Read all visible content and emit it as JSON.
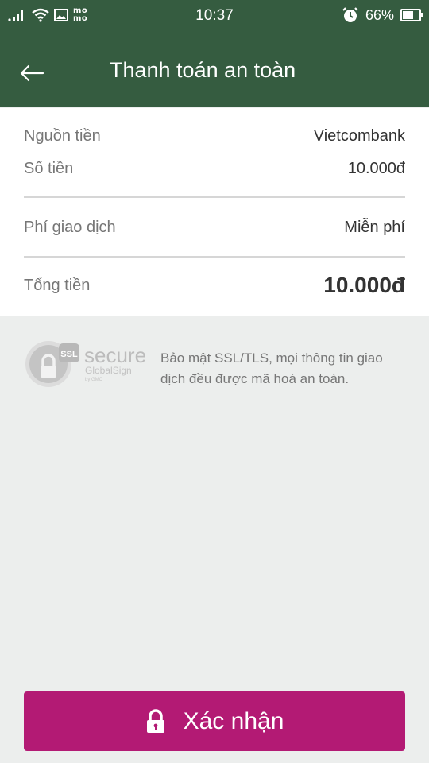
{
  "status_bar": {
    "time": "10:37",
    "battery": "66%",
    "battery_level": 0.66,
    "app_logo_top": "mo",
    "app_logo_bottom": "mo",
    "icons": [
      "signal-icon",
      "wifi-icon",
      "image-icon",
      "momo-logo",
      "alarm-icon",
      "battery-icon"
    ]
  },
  "header": {
    "title": "Thanh toán an toàn",
    "back_icon": "arrow-left-icon",
    "background": "#355c40"
  },
  "summary": {
    "source_label": "Nguồn tiền",
    "source_value": "Vietcombank",
    "amount_label": "Số tiền",
    "amount_value": "10.000đ",
    "fee_label": "Phí giao dịch",
    "fee_value": "Miễn phí",
    "total_label": "Tổng tiền",
    "total_value": "10.000đ"
  },
  "security": {
    "badge_ssl": "SSL",
    "badge_secure": "secure",
    "badge_brand": "GlobalSign",
    "badge_by": "by GMO",
    "note": "Bảo mật SSL/TLS, mọi thông tin giao dịch đều được mã hoá an toàn."
  },
  "footer": {
    "confirm_label": "Xác nhận",
    "confirm_icon": "lock-icon",
    "accent": "#b31a74"
  }
}
